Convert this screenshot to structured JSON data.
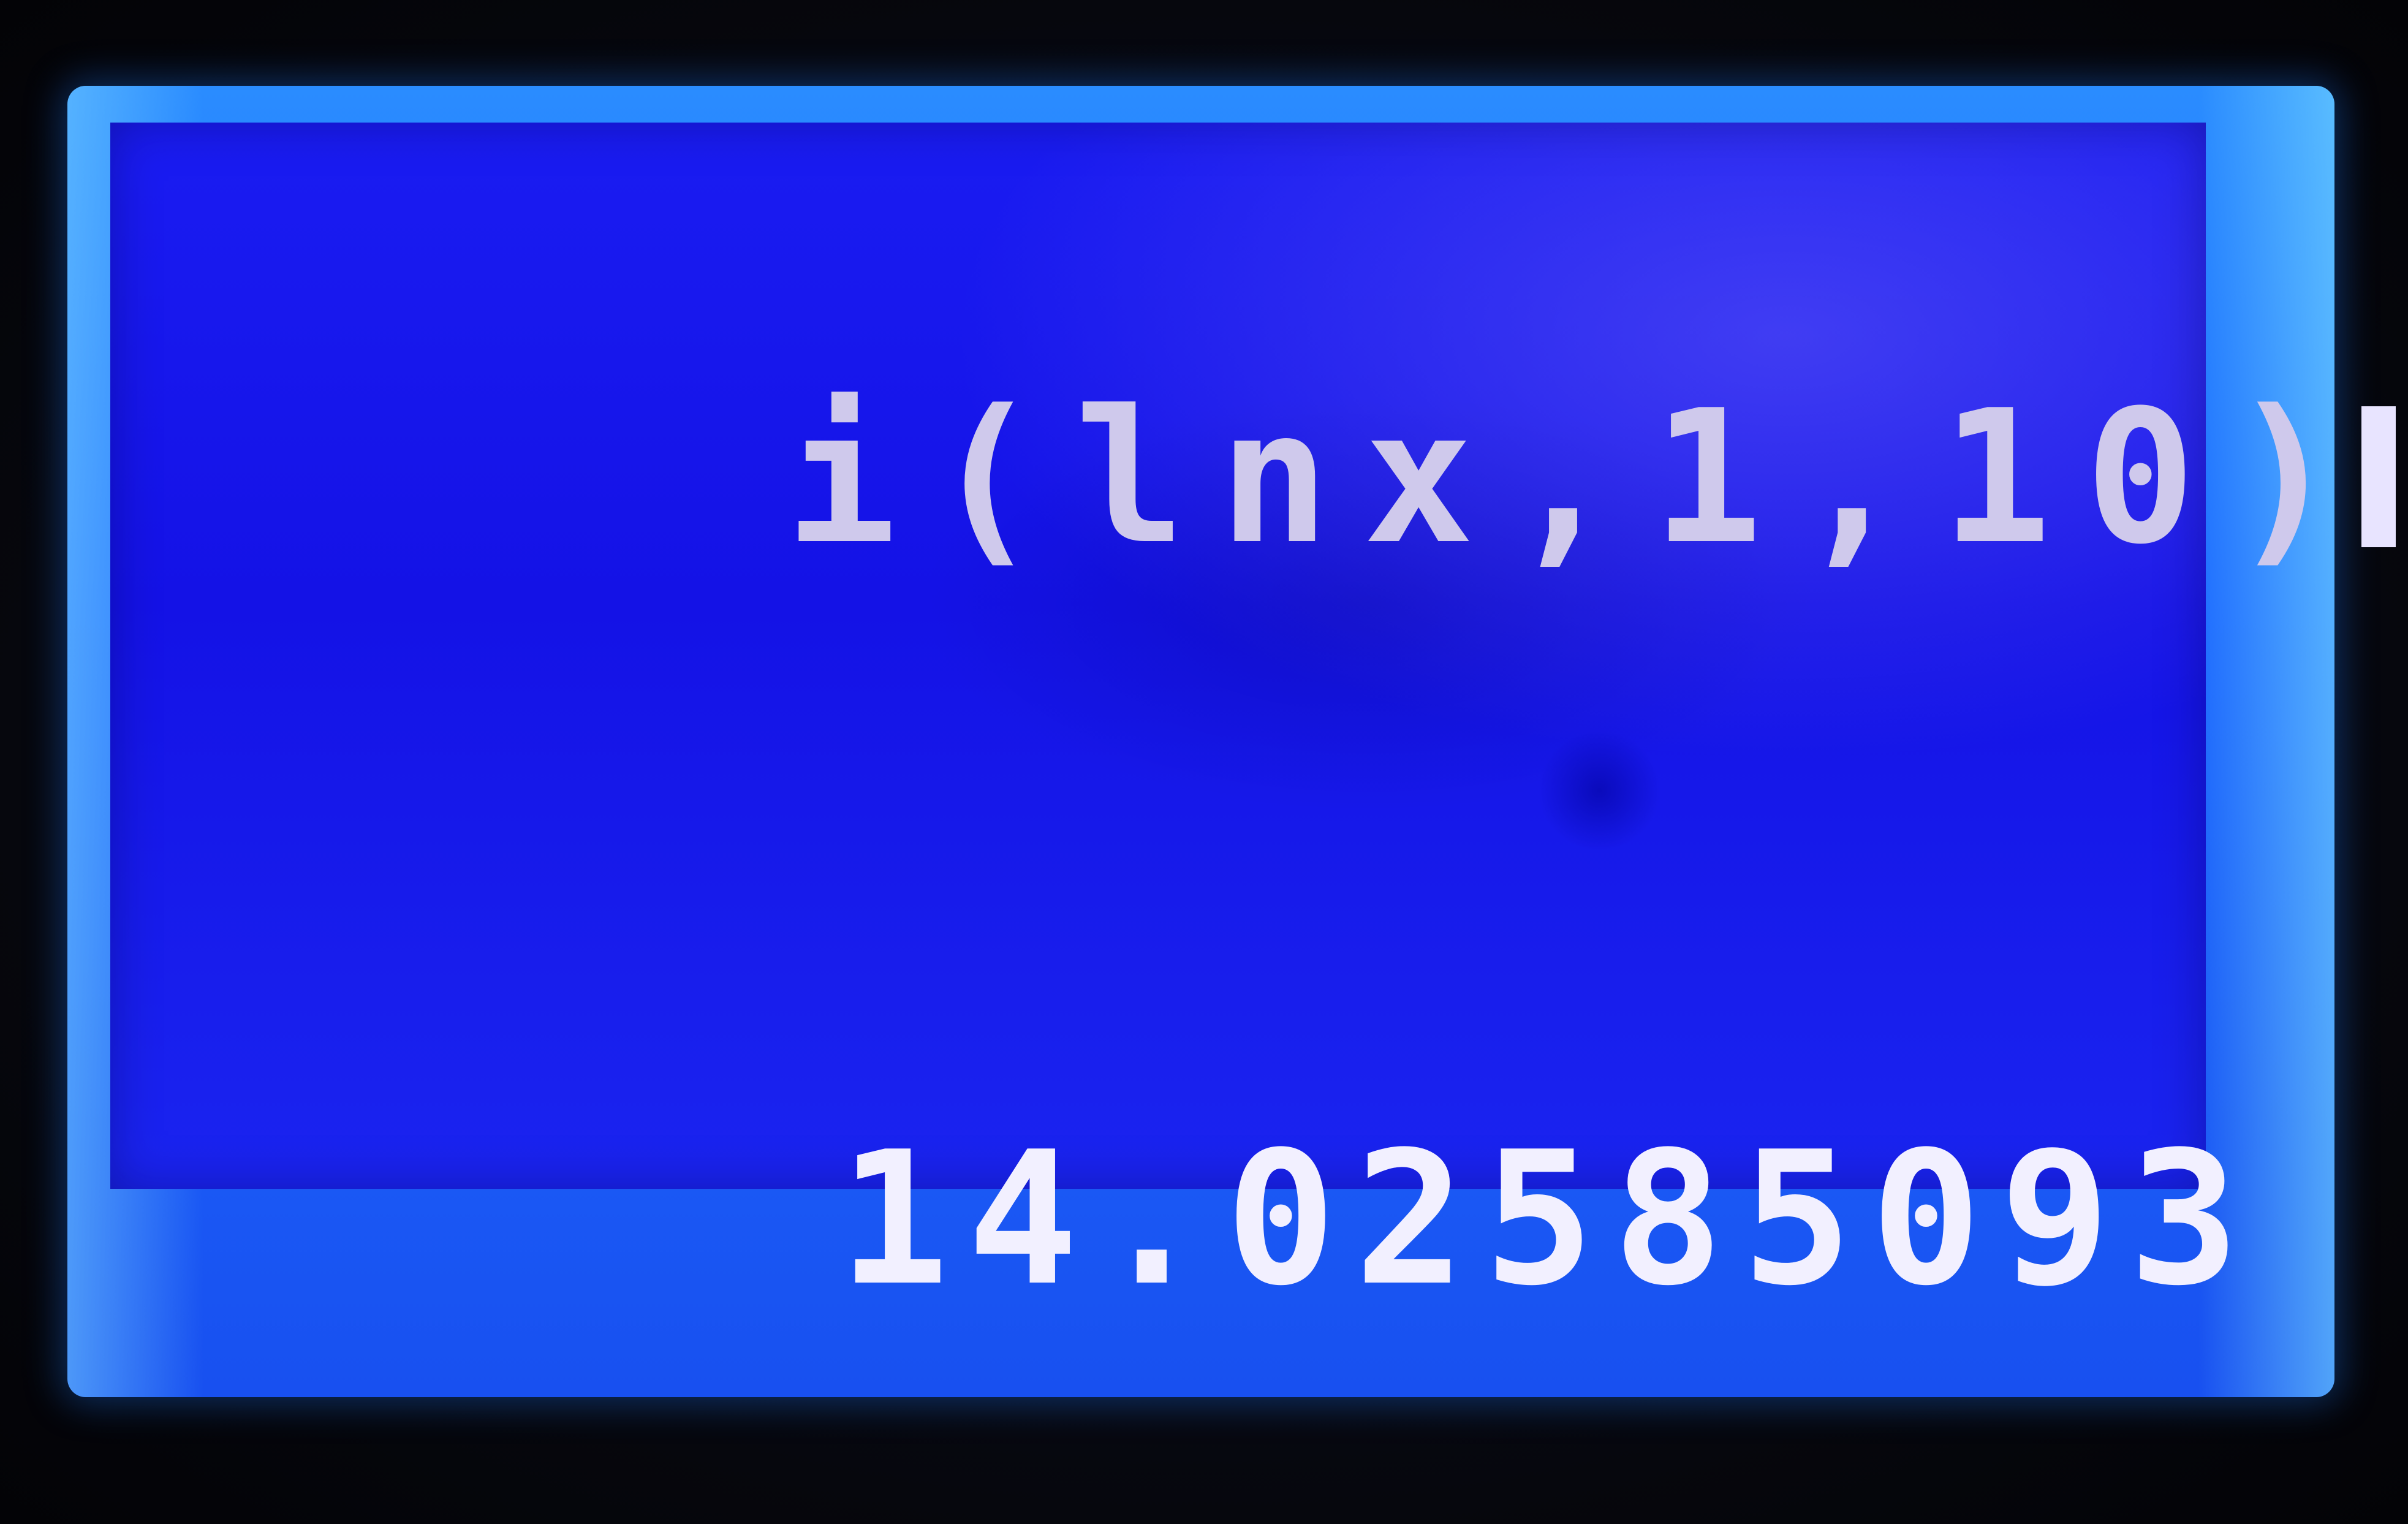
{
  "display": {
    "expression": "i(lnx,1,10)",
    "result": "14.02585093"
  },
  "colors": {
    "lcd_background": "#1412e6",
    "text": "#f2f0ff",
    "backlight_edge": "#2a8cff"
  }
}
